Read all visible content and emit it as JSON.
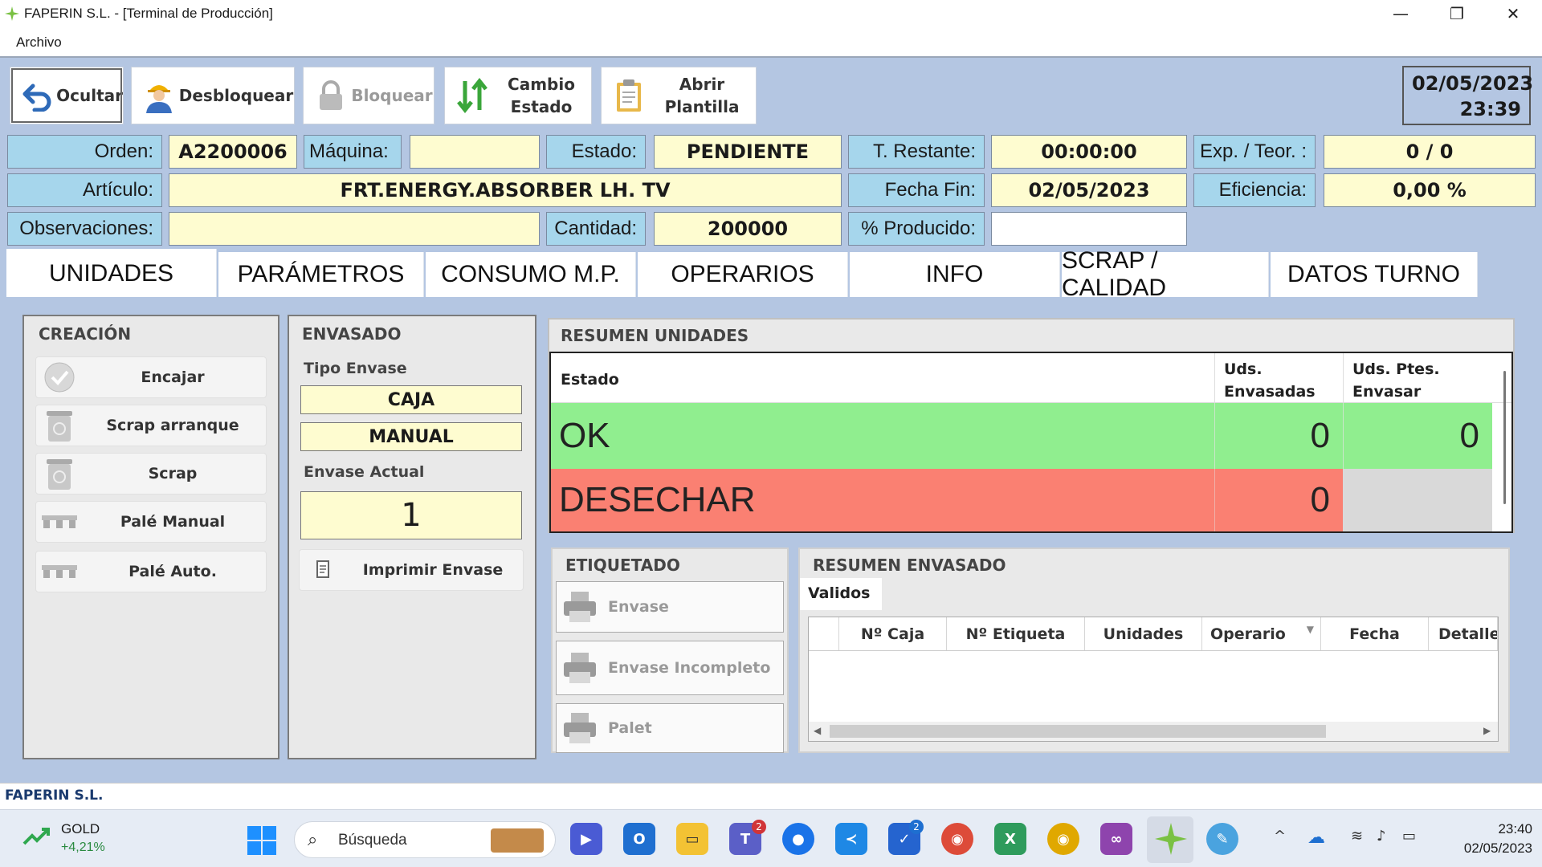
{
  "window": {
    "title": "FAPERIN S.L. - [Terminal de Producción]",
    "minimize": "—",
    "maximize": "❐",
    "close": "✕"
  },
  "menu": {
    "archivo": "Archivo"
  },
  "toolbar": {
    "ocultar": "Ocultar",
    "desbloquear": "Desbloquear",
    "bloquear": "Bloquear",
    "cambio_estado_1": "Cambio",
    "cambio_estado_2": "Estado",
    "abrir_plantilla_1": "Abrir",
    "abrir_plantilla_2": "Plantilla",
    "date": "02/05/2023",
    "time": "23:39"
  },
  "fields": {
    "orden_label": "Orden:",
    "orden_value": "A2200006",
    "maquina_label": "Máquina:",
    "maquina_value": "",
    "estado_label": "Estado:",
    "estado_value": "PENDIENTE",
    "t_restante_label": "T. Restante:",
    "t_restante_value": "00:00:00",
    "exp_teor_label": "Exp. / Teor. :",
    "exp_teor_value": "0 / 0",
    "articulo_label": "Artículo:",
    "articulo_value": "FRT.ENERGY.ABSORBER LH. TV",
    "fecha_fin_label": "Fecha Fin:",
    "fecha_fin_value": "02/05/2023",
    "eficiencia_label": "Eficiencia:",
    "eficiencia_value": "0,00 %",
    "observaciones_label": "Observaciones:",
    "observaciones_value": "",
    "cantidad_label": "Cantidad:",
    "cantidad_value": "200000",
    "producido_label": "% Producido:",
    "producido_value": ""
  },
  "tabs": [
    "UNIDADES",
    "PARÁMETROS",
    "CONSUMO M.P.",
    "OPERARIOS",
    "INFO",
    "SCRAP / CALIDAD",
    "DATOS TURNO"
  ],
  "creacion": {
    "title": "CREACIÓN",
    "encajar": "Encajar",
    "scrap_arranque": "Scrap arranque",
    "scrap": "Scrap",
    "pale_manual": "Palé Manual",
    "pale_auto": "Palé Auto."
  },
  "envasado": {
    "title": "ENVASADO",
    "tipo_envase_label": "Tipo Envase",
    "tipo_envase": "CAJA",
    "modo": "MANUAL",
    "envase_actual_label": "Envase Actual",
    "envase_actual": "1",
    "imprimir": "Imprimir Envase"
  },
  "resumen_unidades": {
    "title": "RESUMEN UNIDADES",
    "col_estado": "Estado",
    "col_envasadas_1": "Uds.",
    "col_envasadas_2": "Envasadas",
    "col_ptes_1": "Uds. Ptes.",
    "col_ptes_2": "Envasar",
    "ok_label": "OK",
    "ok_envasadas": "0",
    "ok_ptes": "0",
    "desechar_label": "DESECHAR",
    "desechar_envasadas": "0",
    "ok_color": "#90ee8f",
    "desechar_color": "#fa8072"
  },
  "etiquetado": {
    "title": "ETIQUETADO",
    "envase": "Envase",
    "envase_incompleto": "Envase Incompleto",
    "palet": "Palet"
  },
  "resumen_envasado": {
    "title": "RESUMEN ENVASADO",
    "tab_validos": "Validos",
    "columns": [
      "Nº Caja",
      "Nº Etiqueta",
      "Unidades",
      "Operario",
      "Fecha",
      "Detalle E"
    ]
  },
  "status": {
    "company": "FAPERIN S.L."
  },
  "taskbar": {
    "stock_name": "GOLD",
    "stock_change": "+4,21%",
    "search": "Búsqueda",
    "teams_badge": "2",
    "todo_badge": "2",
    "time": "23:40",
    "date": "02/05/2023"
  }
}
